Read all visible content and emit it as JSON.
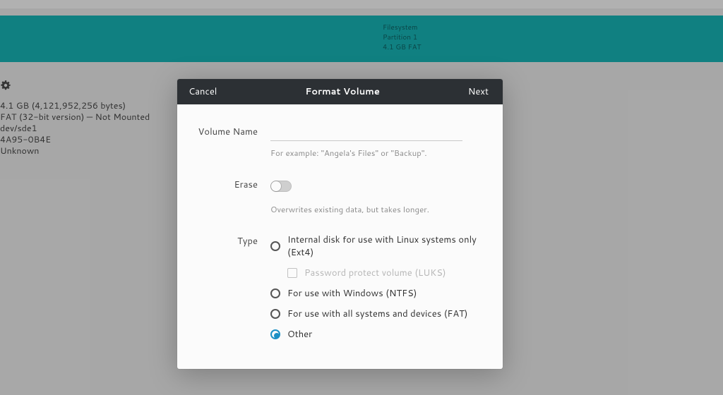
{
  "banner": {
    "line1": "Filesystem",
    "line2": "Partition 1",
    "line3": "4.1 GB FAT"
  },
  "info": {
    "size": "4.1 GB (4,121,952,256 bytes)",
    "contents": "FAT (32-bit version) — Not Mounted",
    "device": "dev/sde1",
    "uuid": "4A95-0B4E",
    "partition_type": "Unknown"
  },
  "dialog": {
    "cancel": "Cancel",
    "title": "Format Volume",
    "next": "Next",
    "volume_name_label": "Volume Name",
    "volume_name_value": "",
    "volume_name_hint": "For example: \"Angela's Files\" or \"Backup\".",
    "erase_label": "Erase",
    "erase_on": false,
    "erase_hint": "Overwrites existing data, but takes longer.",
    "type_label": "Type",
    "options": {
      "ext4": "Internal disk for use with Linux systems only (Ext4)",
      "luks": "Password protect volume (LUKS)",
      "ntfs": "For use with Windows (NTFS)",
      "fat": "For use with all systems and devices (FAT)",
      "other": "Other"
    },
    "selected": "other",
    "accent_color": "#1d90c4"
  }
}
